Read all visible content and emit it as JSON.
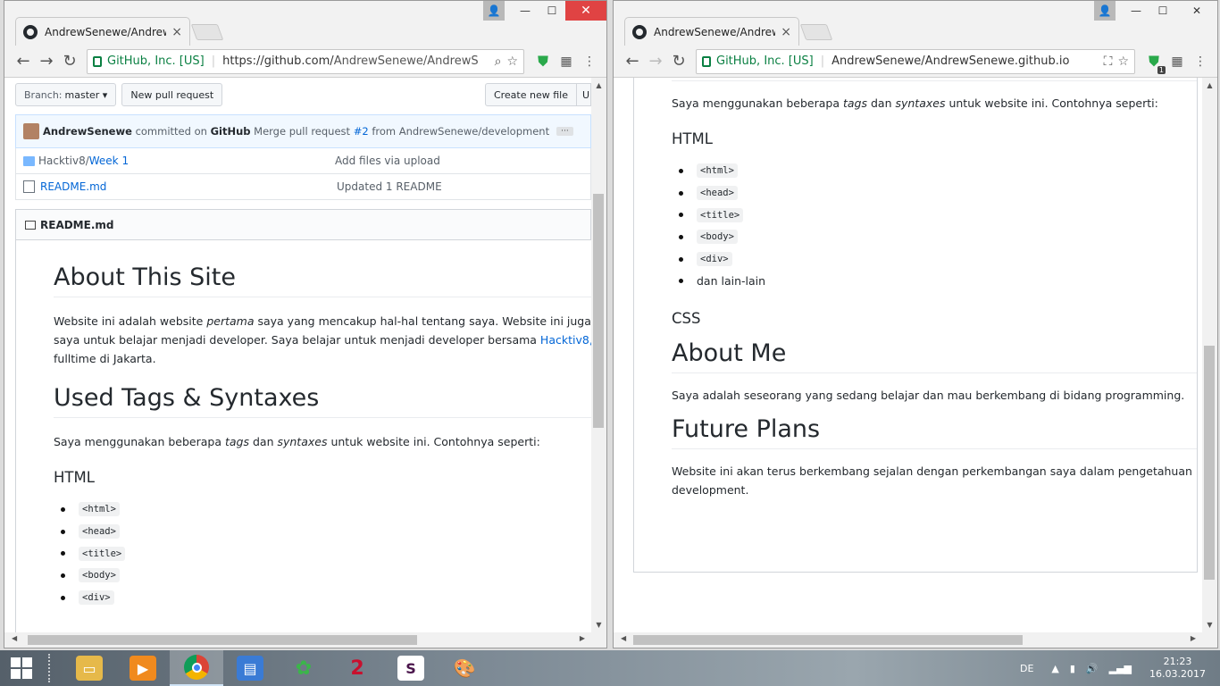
{
  "left_window": {
    "tab_title": "AndrewSenewe/AndrewS",
    "toolbar": {
      "secure_label": "GitHub, Inc. [US]",
      "url_scheme": "https://github.com/",
      "url_path": "AndrewSenewe/AndrewS"
    },
    "repo_bar": {
      "branch_label": "Branch:",
      "branch_value": "master",
      "pull_request": "New pull request",
      "create_file": "Create new file",
      "upload": "Up"
    },
    "commit": {
      "author": "AndrewSenewe",
      "committed_on": "committed on",
      "platform": "GitHub",
      "message_prefix": "Merge pull request",
      "pr": "#2",
      "message_suffix": "from AndrewSenewe/development",
      "more": "···"
    },
    "files": [
      {
        "parent": "Hacktiv8/",
        "name": "Week 1",
        "message": "Add files via upload"
      },
      {
        "parent": "",
        "name": "README.md",
        "message": "Updated 1 README"
      }
    ],
    "readme_title": "README.md",
    "readme": {
      "h1_about": "About This Site",
      "p1_a": "Website ini adalah website ",
      "p1_em": "pertama",
      "p1_b": " saya yang mencakup hal-hal tentang saya. Website ini juga",
      "p2_a": "saya untuk belajar menjadi developer. Saya belajar untuk menjadi developer bersama ",
      "p2_link": "Hacktiv8,",
      "p3": "fulltime di Jakarta.",
      "h1_tags": "Used Tags & Syntaxes",
      "tags_a": "Saya menggunakan beberapa ",
      "tags_em1": "tags",
      "tags_b": " dan ",
      "tags_em2": "syntaxes",
      "tags_c": " untuk website ini. Contohnya seperti:",
      "h3_html": "HTML",
      "html_items": [
        "<html>",
        "<head>",
        "<title>",
        "<body>",
        "<div>"
      ]
    }
  },
  "right_window": {
    "tab_title": "AndrewSenewe/AndrewS",
    "toolbar": {
      "secure_label": "GitHub, Inc. [US]",
      "url": "AndrewSenewe/AndrewSenewe.github.io",
      "ext_badge": "1"
    },
    "content": {
      "tags_a": "Saya menggunakan beberapa ",
      "tags_em1": "tags",
      "tags_b": " dan ",
      "tags_em2": "syntaxes",
      "tags_c": " untuk website ini. Contohnya seperti:",
      "h3_html": "HTML",
      "html_items": [
        "<html>",
        "<head>",
        "<title>",
        "<body>",
        "<div>"
      ],
      "html_last": "dan lain-lain",
      "h3_css": "CSS",
      "h1_about_me": "About Me",
      "about_me": "Saya adalah seseorang yang sedang belajar dan mau berkembang di bidang programming.",
      "h1_future": "Future Plans",
      "future_1": "Website ini akan terus berkembang sejalan dengan perkembangan saya dalam pengetahuan",
      "future_2": "development."
    }
  },
  "taskbar": {
    "language": "DE",
    "time": "21:23",
    "date": "16.03.2017",
    "apps": [
      "file-explorer",
      "media-player",
      "chrome",
      "control-panel",
      "icq",
      "app-2",
      "slack",
      "paint"
    ]
  }
}
